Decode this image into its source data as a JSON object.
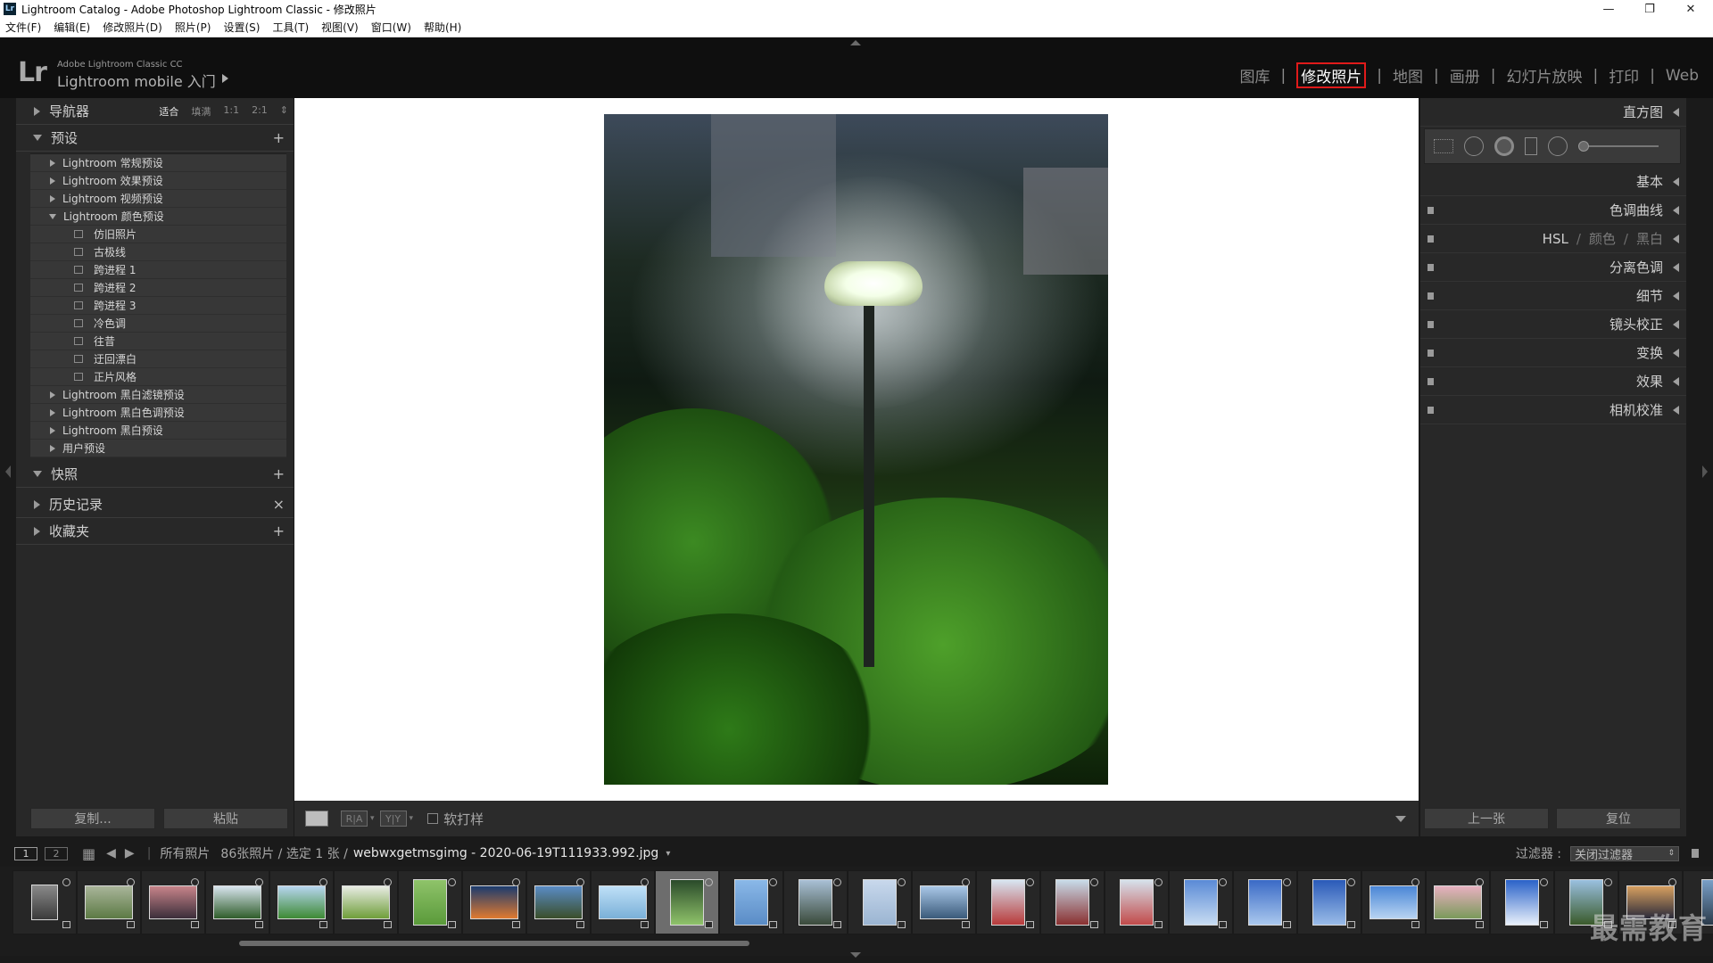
{
  "window": {
    "title": "Lightroom Catalog - Adobe Photoshop Lightroom Classic - 修改照片",
    "app_icon": "Lr",
    "controls": [
      "—",
      "❐",
      "✕"
    ]
  },
  "menu": [
    "文件(F)",
    "编辑(E)",
    "修改照片(D)",
    "照片(P)",
    "设置(S)",
    "工具(T)",
    "视图(V)",
    "窗口(W)",
    "帮助(H)"
  ],
  "identity": {
    "logo": "Lr",
    "small": "Adobe Lightroom Classic CC",
    "big": "Lightroom mobile 入门"
  },
  "modules": {
    "items": [
      "图库",
      "修改照片",
      "地图",
      "画册",
      "幻灯片放映",
      "打印",
      "Web"
    ],
    "active": "修改照片",
    "active_outline_color": "#e01a1a"
  },
  "left_panel": {
    "navigator": {
      "label": "导航器",
      "options": [
        "适合",
        "填满",
        "1:1",
        "2:1"
      ],
      "selected": "适合"
    },
    "presets": {
      "label": "预设",
      "groups": [
        {
          "label": "Lightroom 常规预设",
          "expanded": false
        },
        {
          "label": "Lightroom 效果预设",
          "expanded": false
        },
        {
          "label": "Lightroom 视频预设",
          "expanded": false
        },
        {
          "label": "Lightroom 颜色预设",
          "expanded": true,
          "children": [
            "仿旧照片",
            "古极线",
            "跨进程 1",
            "跨进程 2",
            "跨进程 3",
            "冷色调",
            "往昔",
            "迂回漂白",
            "正片风格"
          ]
        },
        {
          "label": "Lightroom 黑白滤镜预设",
          "expanded": false
        },
        {
          "label": "Lightroom 黑白色调预设",
          "expanded": false
        },
        {
          "label": "Lightroom 黑白预设",
          "expanded": false
        },
        {
          "label": "用户预设",
          "expanded": false
        }
      ]
    },
    "snapshots": "快照",
    "history": "历史记录",
    "collections": "收藏夹",
    "copy_button": "复制...",
    "paste_button": "粘贴"
  },
  "toolbar": {
    "view_ra": "R|A",
    "view_yy": "Y|Y",
    "soft_proof": "软打样"
  },
  "right_panel": {
    "histogram": "直方图",
    "basic": "基本",
    "sections": [
      "色调曲线",
      "分离色调",
      "细节",
      "镜头校正",
      "变换",
      "效果",
      "相机校准"
    ],
    "hsl": [
      "HSL",
      "颜色",
      "黑白"
    ],
    "prev_button": "上一张",
    "reset_button": "复位"
  },
  "filmstrip_bar": {
    "monitor1": "1",
    "monitor2": "2",
    "source": "所有照片",
    "count": "86张照片 / 选定 1 张 /",
    "filename": "webwxgetmsgimg - 2020-06-19T111933.992.jpg",
    "filter_label": "过滤器 :",
    "filter_value": "关闭过滤器"
  },
  "filmstrip": {
    "thumbs": [
      {
        "w": 30,
        "h": 40,
        "c1": "#8a8a8a",
        "c2": "#3a3a3a"
      },
      {
        "w": 54,
        "h": 38,
        "c1": "#a9b59a",
        "c2": "#5c7a44"
      },
      {
        "w": 54,
        "h": 38,
        "c1": "#c8848a",
        "c2": "#3b2e3a"
      },
      {
        "w": 54,
        "h": 38,
        "c1": "#d9e5ef",
        "c2": "#2f5d2a"
      },
      {
        "w": 54,
        "h": 38,
        "c1": "#b7d6f0",
        "c2": "#3d8a34"
      },
      {
        "w": 54,
        "h": 38,
        "c1": "#e8ece4",
        "c2": "#6f9e3a"
      },
      {
        "w": 38,
        "h": 52,
        "c1": "#8fc36a",
        "c2": "#5a9a3a"
      },
      {
        "w": 54,
        "h": 38,
        "c1": "#1b3b6e",
        "c2": "#e07a30"
      },
      {
        "w": 54,
        "h": 38,
        "c1": "#5a8cc6",
        "c2": "#3a4e2a"
      },
      {
        "w": 54,
        "h": 38,
        "c1": "#bfe0f7",
        "c2": "#7ab0d8"
      },
      {
        "w": 38,
        "h": 52,
        "c1": "#2a4a2a",
        "c2": "#8fc36a"
      },
      {
        "w": 38,
        "h": 52,
        "c1": "#8ab8e8",
        "c2": "#5a8cc6"
      },
      {
        "w": 38,
        "h": 52,
        "c1": "#a9c0d6",
        "c2": "#3a4a3a"
      },
      {
        "w": 38,
        "h": 52,
        "c1": "#c8d8ec",
        "c2": "#9bb5d2"
      },
      {
        "w": 54,
        "h": 38,
        "c1": "#aac8e8",
        "c2": "#3a5a7a"
      },
      {
        "w": 38,
        "h": 52,
        "c1": "#d8e6f2",
        "c2": "#b83a3a"
      },
      {
        "w": 38,
        "h": 52,
        "c1": "#c8dcea",
        "c2": "#8a3030"
      },
      {
        "w": 38,
        "h": 52,
        "c1": "#d6e2ec",
        "c2": "#c24a4a"
      },
      {
        "w": 38,
        "h": 52,
        "c1": "#5a8ad6",
        "c2": "#c8dcf2"
      },
      {
        "w": 38,
        "h": 52,
        "c1": "#3a6ac6",
        "c2": "#aac8ee"
      },
      {
        "w": 38,
        "h": 52,
        "c1": "#2a5ab8",
        "c2": "#9abce8"
      },
      {
        "w": 54,
        "h": 38,
        "c1": "#4a86d6",
        "c2": "#b8d4f2"
      },
      {
        "w": 54,
        "h": 38,
        "c1": "#e8b0c0",
        "c2": "#7a9a5a"
      },
      {
        "w": 38,
        "h": 52,
        "c1": "#2a62c8",
        "c2": "#e8f0fa"
      },
      {
        "w": 38,
        "h": 52,
        "c1": "#9ac0e0",
        "c2": "#3a5a2a"
      },
      {
        "w": 54,
        "h": 38,
        "c1": "#d8a060",
        "c2": "#2a2a3a"
      },
      {
        "w": 30,
        "h": 52,
        "c1": "#7aa0c8",
        "c2": "#2a3a4a"
      }
    ],
    "selected_index": 10,
    "watermark": "最需教育"
  }
}
